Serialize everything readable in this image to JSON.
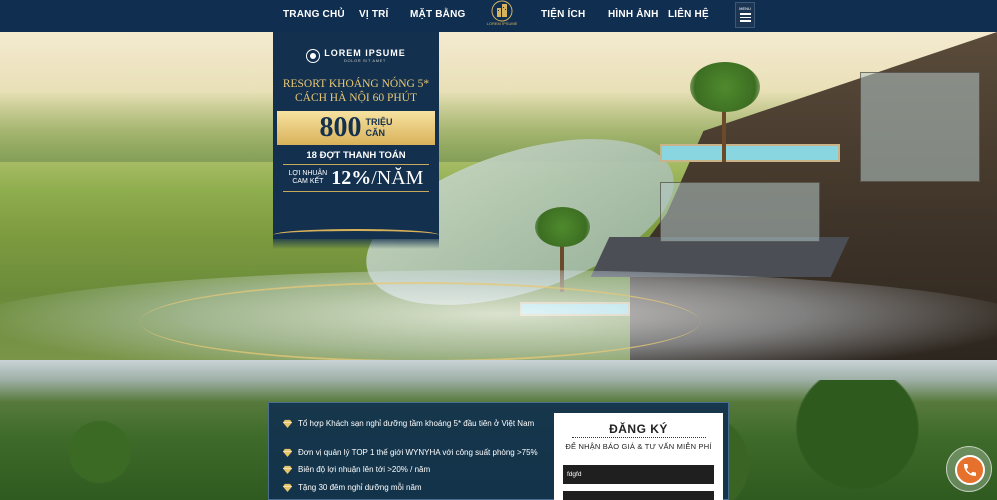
{
  "nav": {
    "items": [
      "TRANG CHỦ",
      "VỊ TRÍ",
      "MẶT BẰNG",
      "TIỆN ÍCH",
      "HÌNH ẢNH",
      "LIÊN HỆ"
    ],
    "logo_text": "LOREM IPSUME",
    "menu_label": "MENU"
  },
  "promo": {
    "brand_name": "LOREM IPSUME",
    "brand_sub": "DOLOR SIT AMET",
    "line1": "RESORT KHOÁNG NÓNG 5*",
    "line2": "CÁCH HÀ NỘI 60 PHÚT",
    "price_value": "800",
    "price_unit_top": "TRIỆU",
    "price_unit_bottom": "CĂN",
    "installments": "18 ĐỢT THANH TOÁN",
    "profit_label_1": "LỢI NHUẬN",
    "profit_label_2": "CAM KẾT",
    "profit_value": "12%",
    "profit_suffix": "/NĂM"
  },
  "benefits": [
    "Tổ hợp Khách sạn nghỉ dưỡng tầm khoáng 5* đầu tiên ở Việt Nam",
    "Đơn vị quản lý TOP 1 thế giới WYNYHA với công suất phòng >75%",
    "Biên độ lợi nhuận lên tới >20% / năm",
    "Tặng 30 đêm nghỉ dưỡng mỗi năm"
  ],
  "form": {
    "title": "ĐĂNG KÝ",
    "subtitle": "ĐỂ NHẬN BÁO GIÁ & TƯ VẤN MIỄN PHÍ",
    "name_value": "fdgfd",
    "phone_value": ""
  },
  "colors": {
    "navy": "#0f2e50",
    "gold": "#d8b25a",
    "call": "#e5712d"
  },
  "icons": {
    "benefit": "diamond-icon",
    "call": "phone-icon",
    "menu": "hamburger-icon"
  }
}
